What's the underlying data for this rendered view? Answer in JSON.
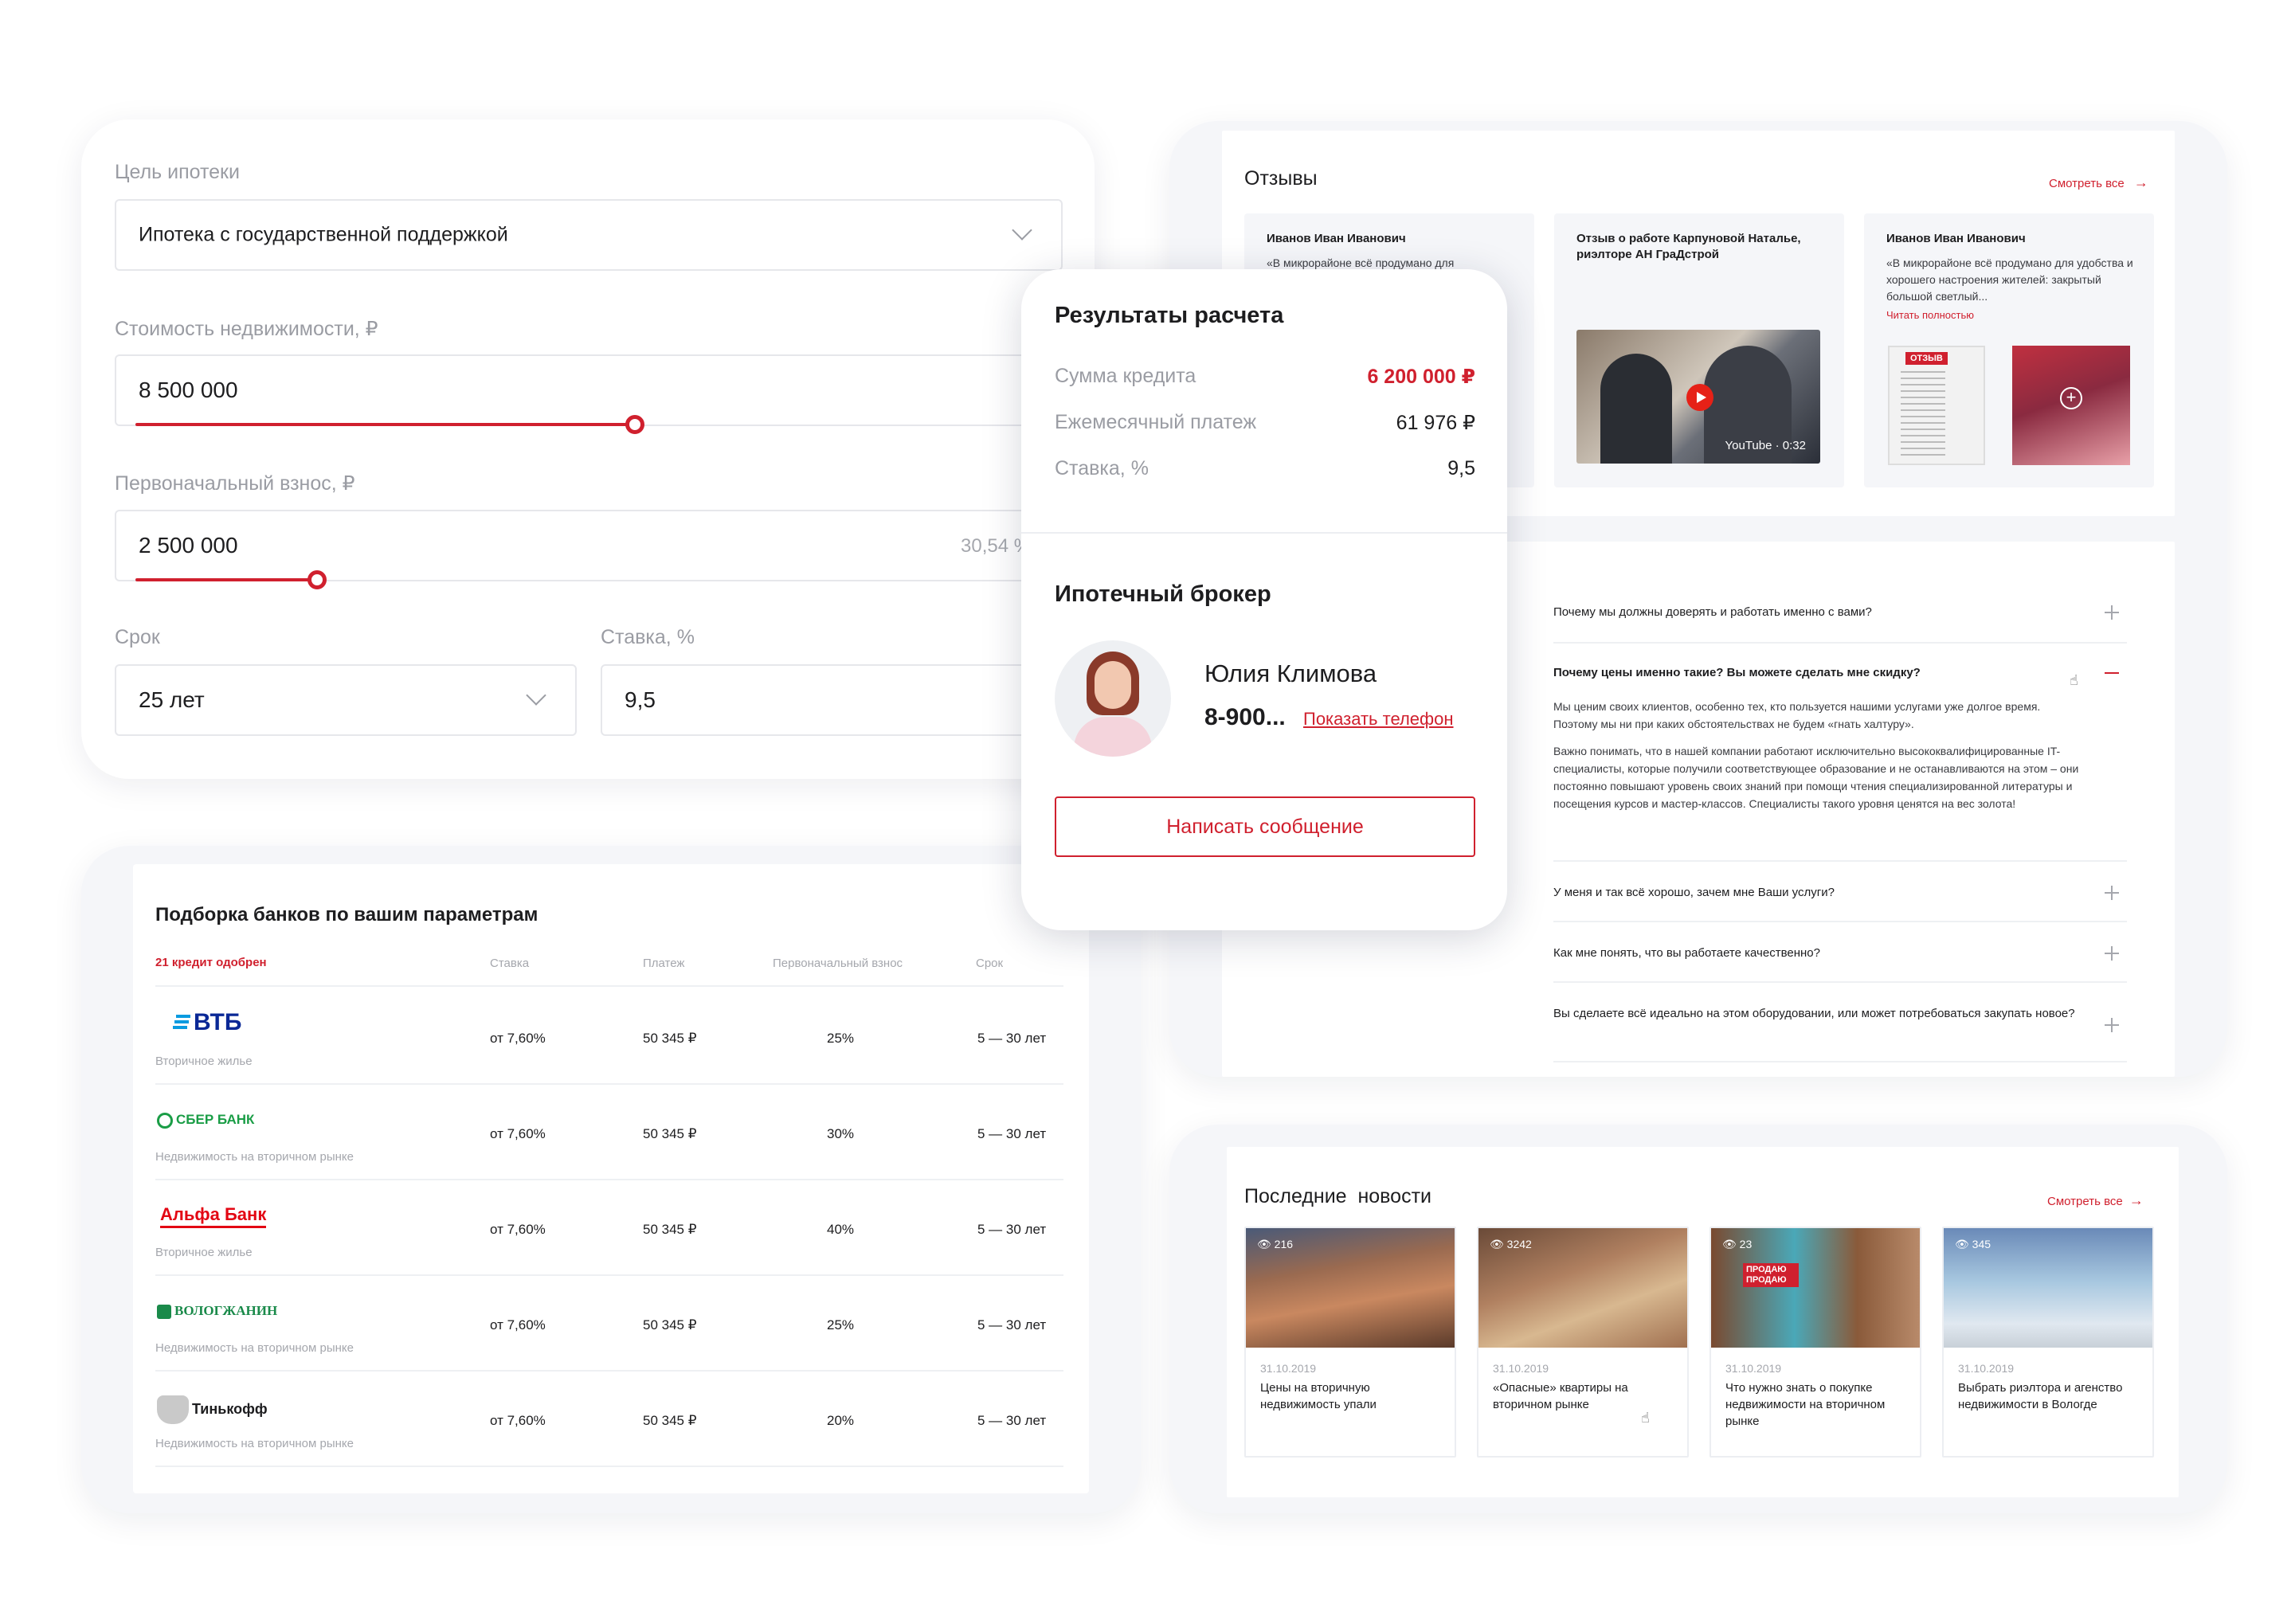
{
  "calculator": {
    "purpose_label": "Цель ипотеки",
    "purpose_value": "Ипотека с государственной поддержкой",
    "price_label": "Стоимость недвижимости, ₽",
    "price_value": "8 500 000",
    "price_slider_fraction": 0.55,
    "down_label": "Первоначальный взнос, ₽",
    "down_value": "2 500 000",
    "down_percent": "30,54 %",
    "down_slider_fraction": 0.2,
    "term_label": "Срок",
    "term_value": "25 лет",
    "rate_label": "Ставка, %",
    "rate_value": "9,5"
  },
  "results": {
    "title": "Результаты расчета",
    "loan_label": "Сумма кредита",
    "loan_value": "6 200 000 ₽",
    "monthly_label": "Ежемесячный платеж",
    "monthly_value": "61 976 ₽",
    "rate_label": "Ставка, %",
    "rate_value": "9,5",
    "broker_title": "Ипотечный брокер",
    "broker_name": "Юлия Климова",
    "broker_phone": "8-900...",
    "show_phone": "Показать телефон",
    "message_button": "Написать сообщение"
  },
  "banks": {
    "title": "Подборка банков по вашим параметрам",
    "approved": "21 кредит одобрен",
    "headers": {
      "rate": "Ставка",
      "payment": "Платеж",
      "down": "Первоначальный взнос",
      "term": "Срок"
    },
    "rows": [
      {
        "name": "ВТБ",
        "type": "Вторичное жилье",
        "rate": "от 7,60%",
        "payment": "50 345 ₽",
        "down": "25%",
        "term": "5 — 30 лет"
      },
      {
        "name": "СБЕР БАНК",
        "type": "Недвижимость на вторичном рынке",
        "rate": "от 7,60%",
        "payment": "50 345 ₽",
        "down": "30%",
        "term": "5 — 30 лет"
      },
      {
        "name": "Альфа Банк",
        "type": "Вторичное жилье",
        "rate": "от 7,60%",
        "payment": "50 345 ₽",
        "down": "40%",
        "term": "5 — 30 лет"
      },
      {
        "name": "ВОЛОГЖАНИН",
        "type": "Недвижимость на вторичном рынке",
        "rate": "от 7,60%",
        "payment": "50 345 ₽",
        "down": "25%",
        "term": "5 — 30 лет"
      },
      {
        "name": "Тинькофф",
        "type": "Недвижимость на вторичном рынке",
        "rate": "от 7,60%",
        "payment": "50 345 ₽",
        "down": "20%",
        "term": "5 — 30 лет"
      }
    ]
  },
  "reviews": {
    "title": "Отзывы",
    "see_all": "Смотреть все",
    "items": [
      {
        "author": "Иванов Иван Иванович",
        "text": "«В микрорайоне всё продумано для"
      },
      {
        "author": "Отзыв о работе Карпуновой Наталье, риэлторе АН ГраДстрой",
        "video_label": "YouTube · 0:32"
      },
      {
        "author": "Иванов Иван Иванович",
        "text": "«В микрорайоне всё продумано для удобства и хорошего настроения жителей: закрытый большой светлый...",
        "read_more": "Читать полностью",
        "badge": "ОТЗЫВ"
      }
    ]
  },
  "faq": {
    "items": [
      {
        "q": "Почему мы должны доверять и работать именно с вами?"
      },
      {
        "q": "Почему цены именно такие? Вы можете сделать мне скидку?",
        "a1": "Мы ценим своих клиентов, особенно тех, кто пользуется нашими услугами уже долгое время. Поэтому мы ни при каких обстоятельствах не будем «гнать халтуру».",
        "a2": "Важно понимать, что в нашей компании работают исключительно высококвалифицированные IT-специалисты, которые получили соответствующее образование и не останавливаются на этом – они постоянно повышают уровень своих знаний при помощи чтения специализированной литературы и посещения курсов и мастер-классов. Специалисты такого уровня ценятся на вес золота!"
      },
      {
        "q": "У меня и так всё хорошо, зачем мне Ваши услуги?"
      },
      {
        "q": "Как мне понять, что вы работаете качественно?"
      },
      {
        "q": "Вы сделаете всё идеально на этом оборудовании, или может потребоваться закупать новое?"
      }
    ]
  },
  "news": {
    "title": "Последние  новости",
    "see_all": "Смотреть все",
    "items": [
      {
        "views": "216",
        "date": "31.10.2019",
        "title": "Цены на вторичную недвижимость упали"
      },
      {
        "views": "3242",
        "date": "31.10.2019",
        "title": "«Опасные» квартиры на вторичном рынке"
      },
      {
        "views": "23",
        "date": "31.10.2019",
        "title": "Что нужно знать о покупке недвижимости на вторичном рынке",
        "badge": "ПРОДАЮ ПРОДАЮ"
      },
      {
        "views": "345",
        "date": "31.10.2019",
        "title": "Выбрать риэлтора и агенство недвижимости в Вологде"
      }
    ]
  },
  "colors": {
    "accent": "#d0202e",
    "text": "#1d1d1f",
    "muted": "#9a9ca3",
    "panel": "#f5f6f9"
  }
}
